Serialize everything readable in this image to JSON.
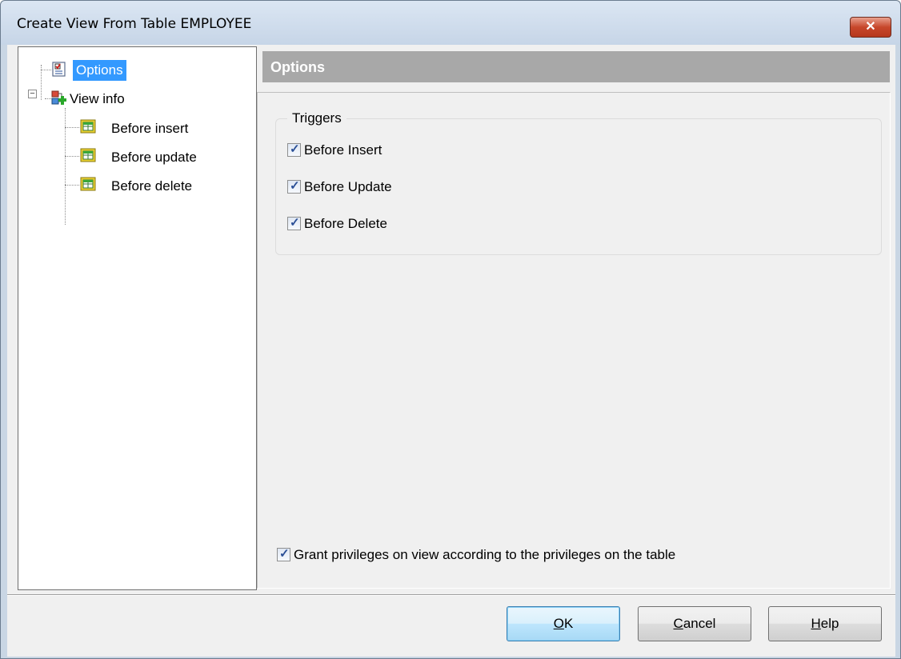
{
  "window": {
    "title": "Create View From Table EMPLOYEE",
    "close_glyph": "✕"
  },
  "tree": {
    "items": [
      {
        "label": "Options",
        "icon": "checklist-icon",
        "selected": true
      },
      {
        "label": "View info",
        "icon": "view-icon",
        "expander": "−"
      },
      {
        "label": "Before insert",
        "icon": "trigger-icon"
      },
      {
        "label": "Before update",
        "icon": "trigger-icon"
      },
      {
        "label": "Before delete",
        "icon": "trigger-icon"
      }
    ]
  },
  "panel": {
    "header": "Options",
    "triggers_group": {
      "title": "Triggers",
      "checkboxes": [
        {
          "label": "Before Insert",
          "checked": true
        },
        {
          "label": "Before Update",
          "checked": true
        },
        {
          "label": "Before Delete",
          "checked": true
        }
      ]
    },
    "grant_privileges": {
      "label": "Grant privileges on view according to the privileges on the table",
      "checked": true
    }
  },
  "buttons": {
    "ok": {
      "mnemonic": "O",
      "rest": "K"
    },
    "cancel": {
      "mnemonic": "C",
      "rest": "ancel"
    },
    "help": {
      "mnemonic": "H",
      "rest": "elp"
    }
  },
  "check_glyph": "✓",
  "colors": {
    "selection": "#3399ff",
    "header_bar": "#a8a8a8",
    "close_button": "#c7472b"
  }
}
